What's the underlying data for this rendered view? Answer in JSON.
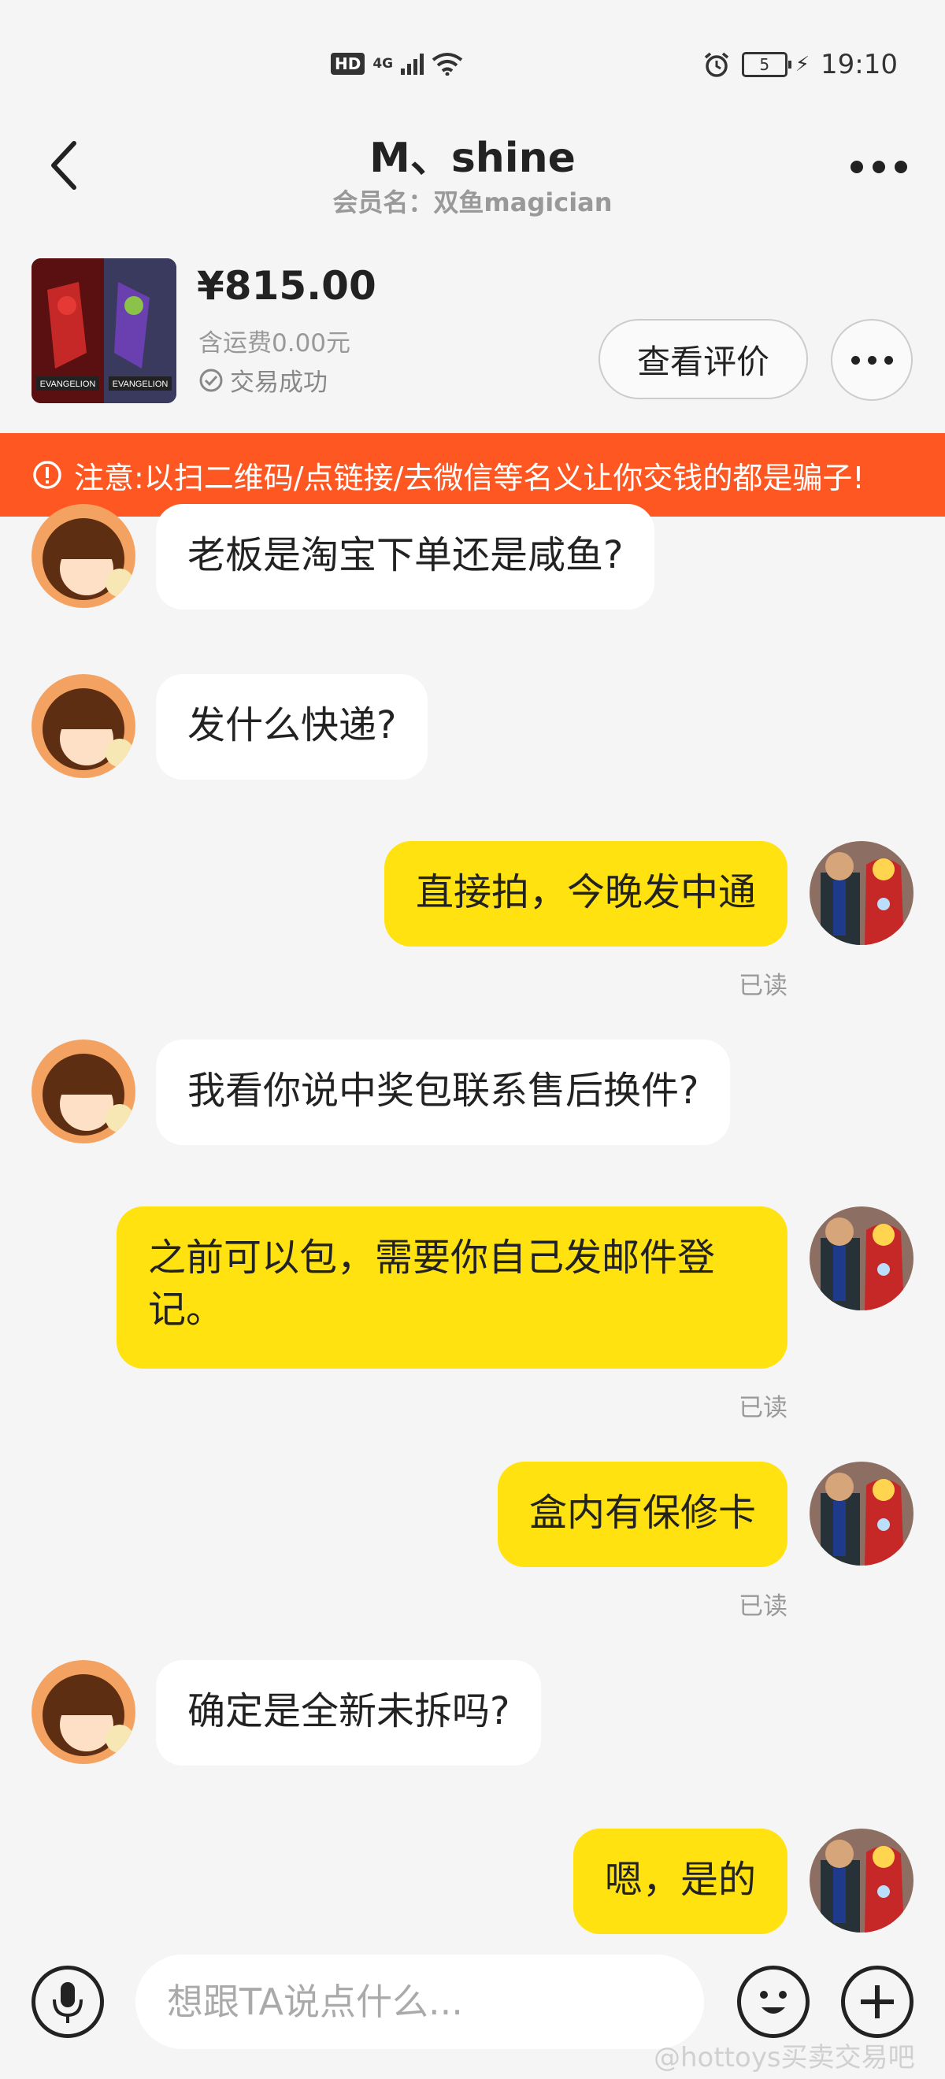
{
  "status_bar": {
    "hd": "HD",
    "network": "4G",
    "battery": "5",
    "time": "19:10"
  },
  "header": {
    "title": "M、shine",
    "subtitle": "会员名：双鱼magician"
  },
  "product": {
    "price": "¥815.00",
    "shipping": "含运费0.00元",
    "status": "交易成功",
    "review_button": "查看评价",
    "thumb_label_left": "EVANGELION",
    "thumb_label_right": "EVANGELION"
  },
  "warning": {
    "text": "注意:以扫二维码/点链接/去微信等名义让你交钱的都是骗子!"
  },
  "messages": [
    {
      "side": "in",
      "text": "老板是淘宝下单还是咸鱼?"
    },
    {
      "side": "in",
      "text": "发什么快递?"
    },
    {
      "side": "out",
      "text": "直接拍，今晚发中通",
      "read": "已读"
    },
    {
      "side": "in",
      "text": "我看你说中奖包联系售后换件?"
    },
    {
      "side": "out",
      "text": "之前可以包，需要你自己发邮件登记。",
      "read": "已读"
    },
    {
      "side": "out",
      "text": "盒内有保修卡",
      "read": "已读"
    },
    {
      "side": "in",
      "text": "确定是全新未拆吗?"
    },
    {
      "side": "out",
      "text": "嗯，是的"
    }
  ],
  "input": {
    "placeholder": "想跟TA说点什么..."
  },
  "watermark": "@hottoys买卖交易吧",
  "colors": {
    "accent_yellow": "#ffe210",
    "warning_orange": "#ff5722",
    "background": "#f5f5f5"
  }
}
